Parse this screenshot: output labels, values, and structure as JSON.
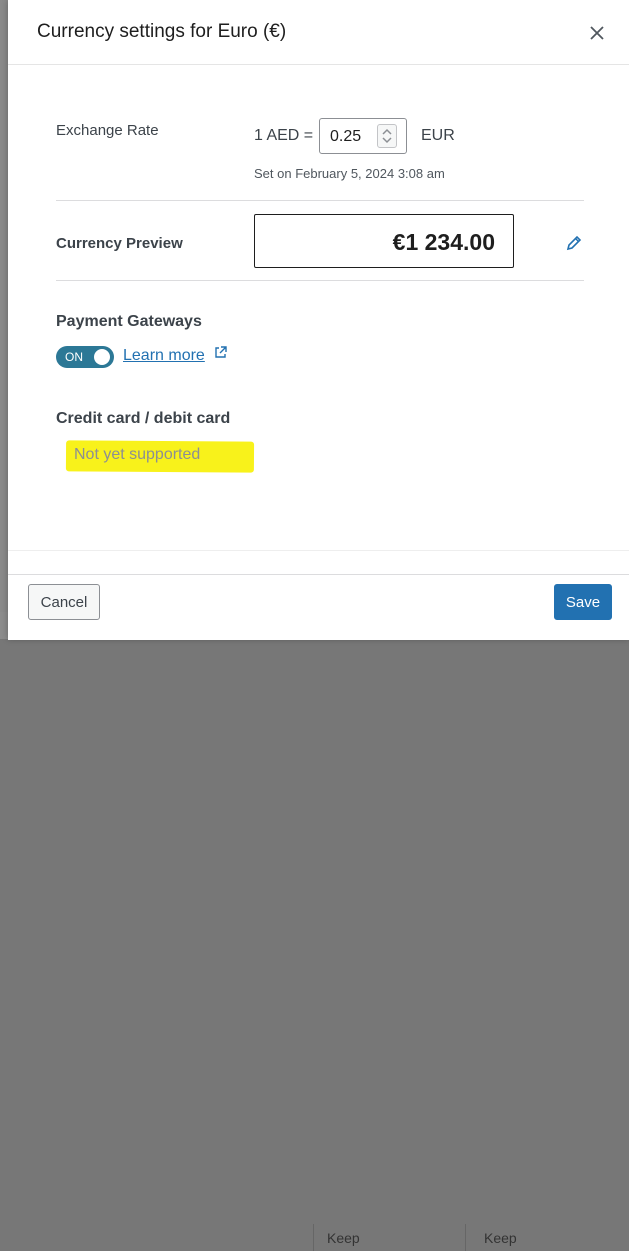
{
  "background": {
    "left_text_1": "",
    "mid_text": "Keep",
    "right_text": "Keep"
  },
  "modal": {
    "title": "Currency settings for Euro (€)",
    "close_icon": "close-icon"
  },
  "exchange_rate": {
    "label": "Exchange Rate",
    "prefix": "1 AED =",
    "value": "0.25",
    "suffix": "EUR",
    "note": "Set on February 5, 2024 3:08 am"
  },
  "preview": {
    "label": "Currency Preview",
    "value": "€1 234.00",
    "edit_icon": "pencil-icon"
  },
  "gateways": {
    "label": "Payment Gateways",
    "toggle_text": "ON",
    "toggle_state": "on",
    "learn_more": "Learn more",
    "external_icon": "external-link-icon"
  },
  "credit_card": {
    "label": "Credit card / debit card",
    "status": "Not yet supported",
    "highlight_color": "#f8f21b"
  },
  "footer": {
    "cancel_label": "Cancel",
    "save_label": "Save"
  },
  "colors": {
    "accent": "#2271b1",
    "toggle": "#2c7896"
  }
}
